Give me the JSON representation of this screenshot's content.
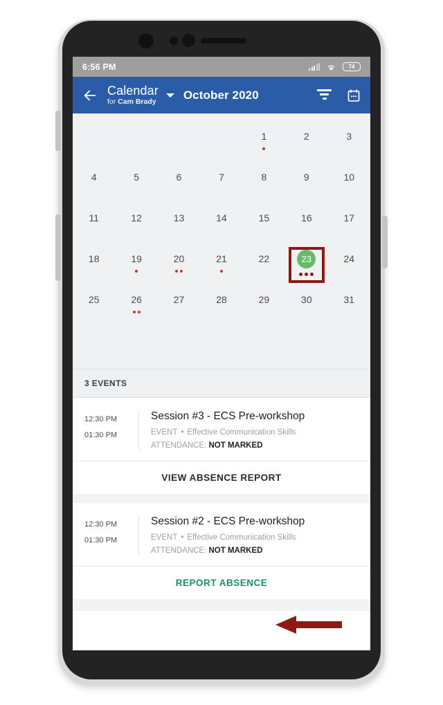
{
  "status_bar": {
    "time": "6:56 PM",
    "signal_icon": "signal-bars-icon",
    "wifi_icon": "wifi-icon",
    "battery_icon": "battery-icon",
    "battery_level": "74"
  },
  "app_bar": {
    "back_icon": "back-arrow-icon",
    "title": "Calendar",
    "subtitle_prefix": "for ",
    "subtitle_name": "Cam Brady",
    "dropdown_icon": "chevron-down-icon",
    "month": "October 2020",
    "filter_icon": "filter-icon",
    "calendar_icon": "calendar-icon",
    "background_color": "#2b5ca8"
  },
  "calendar": {
    "background_color": "#eff1f3",
    "selected_day": 23,
    "selected_circle_color": "#66bb6a",
    "annotation_box_color": "#8c1a12",
    "event_dot_color": "#c0392b",
    "weeks": [
      [
        null,
        null,
        null,
        null,
        1,
        2,
        3
      ],
      [
        4,
        5,
        6,
        7,
        8,
        9,
        10
      ],
      [
        11,
        12,
        13,
        14,
        15,
        16,
        17
      ],
      [
        18,
        19,
        20,
        21,
        22,
        23,
        24
      ],
      [
        25,
        26,
        27,
        28,
        29,
        30,
        31
      ]
    ],
    "dots": {
      "1": 1,
      "19": 1,
      "20": 2,
      "21": 1,
      "23": 3,
      "26": 2
    }
  },
  "events_header": "3 EVENTS",
  "events": [
    {
      "start_time": "12:30 PM",
      "end_time": "01:30 PM",
      "title": "Session #3 - ECS Pre-workshop",
      "type": "EVENT",
      "separator": "•",
      "category": "Effective Communication Skills",
      "attendance_label": "ATTENDANCE:",
      "attendance_value": "NOT MARKED",
      "action_label": "VIEW ABSENCE REPORT",
      "action_color": "#2b2b2b"
    },
    {
      "start_time": "12:30 PM",
      "end_time": "01:30 PM",
      "title": "Session #2 - ECS Pre-workshop",
      "type": "EVENT",
      "separator": "•",
      "category": "Effective Communication Skills",
      "attendance_label": "ATTENDANCE:",
      "attendance_value": "NOT MARKED",
      "action_label": "REPORT ABSENCE",
      "action_color": "#1a8f63"
    }
  ],
  "annotation": {
    "arrow_icon": "left-arrow-annotation",
    "arrow_color": "#8c1a12",
    "points_at": "REPORT ABSENCE"
  }
}
